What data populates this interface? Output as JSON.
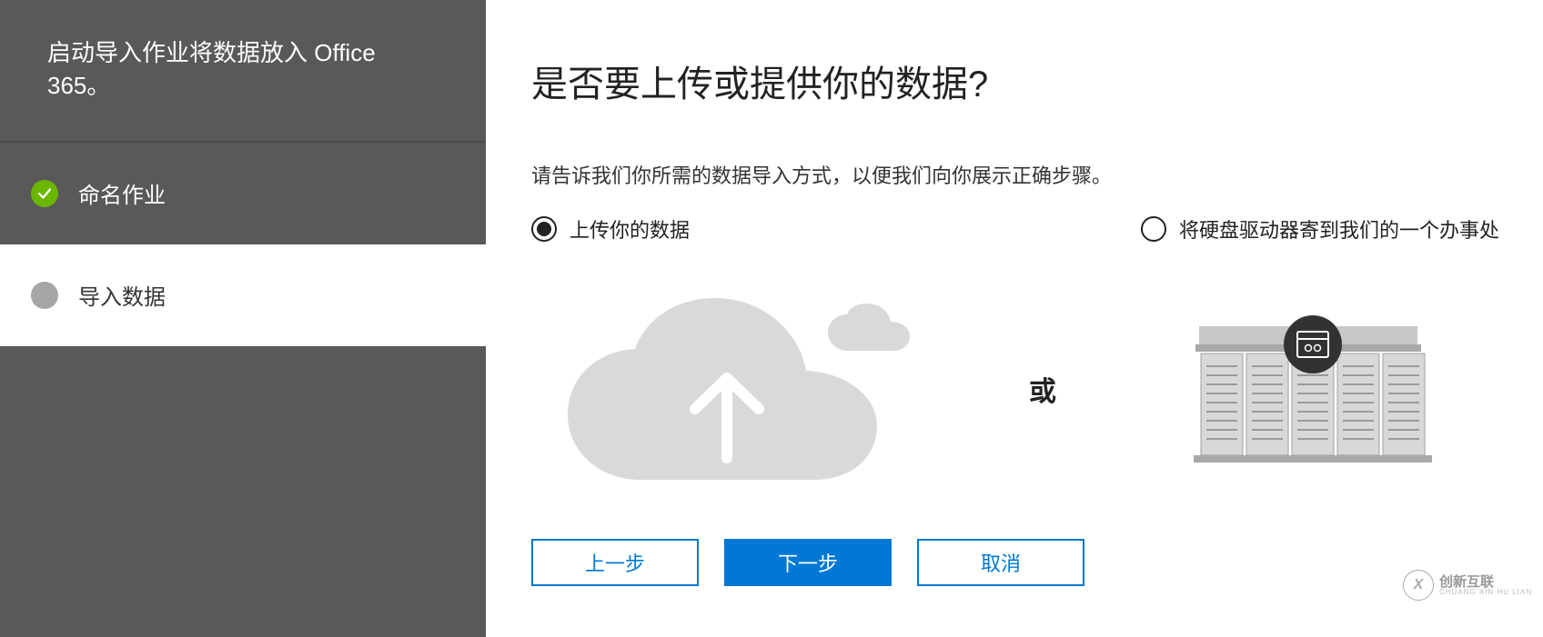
{
  "sidebar": {
    "title": "启动导入作业将数据放入 Office 365。",
    "steps": [
      {
        "label": "命名作业",
        "state": "completed"
      },
      {
        "label": "导入数据",
        "state": "current"
      }
    ]
  },
  "main": {
    "title": "是否要上传或提供你的数据?",
    "description": "请告诉我们你所需的数据导入方式，以便我们向你展示正确步骤。",
    "option_upload_label": "上传你的数据",
    "option_ship_label": "将硬盘驱动器寄到我们的一个办事处",
    "or_label": "或",
    "buttons": {
      "back": "上一步",
      "next": "下一步",
      "cancel": "取消"
    }
  },
  "watermark": {
    "logo_text": "X",
    "cn": "创新互联",
    "en": "CHUANG XIN HU LIAN"
  },
  "colors": {
    "sidebar_bg": "#595959",
    "accent": "#0078d4",
    "success": "#6bb700"
  }
}
